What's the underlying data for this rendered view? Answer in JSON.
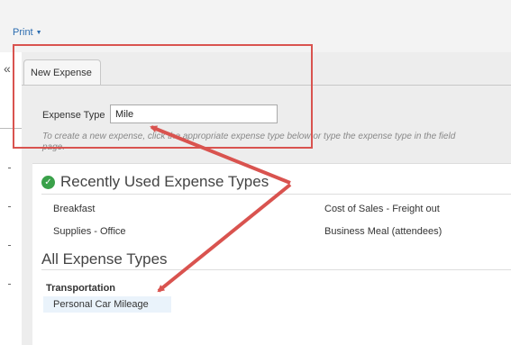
{
  "header": {
    "print_label": "Print"
  },
  "sidebar": {
    "collapse_glyph": "«"
  },
  "form": {
    "tab_label": "New Expense",
    "expense_type_label": "Expense Type",
    "expense_type_value": "Mile",
    "instructions_line1": "To create a new expense, click the appropriate expense type below or type the expense type in the field",
    "instructions_line2": "page."
  },
  "recent": {
    "heading": "Recently Used Expense Types",
    "items": [
      "Breakfast",
      "Cost of Sales - Freight out",
      "Supplies - Office",
      "Business Meal (attendees)"
    ]
  },
  "all_types": {
    "heading": "All Expense Types",
    "category": "Transportation",
    "item": "Personal Car Mileage"
  },
  "colors": {
    "annotation": "#d9534f",
    "link": "#2b6cb0",
    "success": "#3aa14a"
  }
}
